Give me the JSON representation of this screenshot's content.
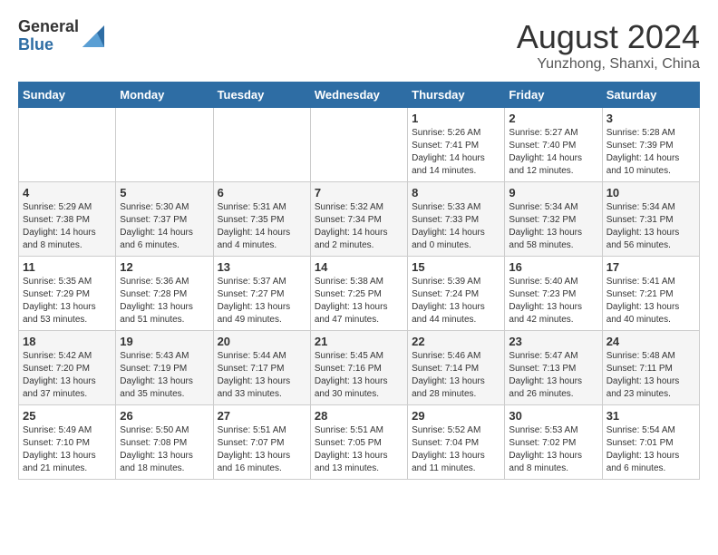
{
  "logo": {
    "general": "General",
    "blue": "Blue"
  },
  "title": "August 2024",
  "subtitle": "Yunzhong, Shanxi, China",
  "days_of_week": [
    "Sunday",
    "Monday",
    "Tuesday",
    "Wednesday",
    "Thursday",
    "Friday",
    "Saturday"
  ],
  "weeks": [
    [
      {
        "day": "",
        "info": ""
      },
      {
        "day": "",
        "info": ""
      },
      {
        "day": "",
        "info": ""
      },
      {
        "day": "",
        "info": ""
      },
      {
        "day": "1",
        "info": "Sunrise: 5:26 AM\nSunset: 7:41 PM\nDaylight: 14 hours\nand 14 minutes."
      },
      {
        "day": "2",
        "info": "Sunrise: 5:27 AM\nSunset: 7:40 PM\nDaylight: 14 hours\nand 12 minutes."
      },
      {
        "day": "3",
        "info": "Sunrise: 5:28 AM\nSunset: 7:39 PM\nDaylight: 14 hours\nand 10 minutes."
      }
    ],
    [
      {
        "day": "4",
        "info": "Sunrise: 5:29 AM\nSunset: 7:38 PM\nDaylight: 14 hours\nand 8 minutes."
      },
      {
        "day": "5",
        "info": "Sunrise: 5:30 AM\nSunset: 7:37 PM\nDaylight: 14 hours\nand 6 minutes."
      },
      {
        "day": "6",
        "info": "Sunrise: 5:31 AM\nSunset: 7:35 PM\nDaylight: 14 hours\nand 4 minutes."
      },
      {
        "day": "7",
        "info": "Sunrise: 5:32 AM\nSunset: 7:34 PM\nDaylight: 14 hours\nand 2 minutes."
      },
      {
        "day": "8",
        "info": "Sunrise: 5:33 AM\nSunset: 7:33 PM\nDaylight: 14 hours\nand 0 minutes."
      },
      {
        "day": "9",
        "info": "Sunrise: 5:34 AM\nSunset: 7:32 PM\nDaylight: 13 hours\nand 58 minutes."
      },
      {
        "day": "10",
        "info": "Sunrise: 5:34 AM\nSunset: 7:31 PM\nDaylight: 13 hours\nand 56 minutes."
      }
    ],
    [
      {
        "day": "11",
        "info": "Sunrise: 5:35 AM\nSunset: 7:29 PM\nDaylight: 13 hours\nand 53 minutes."
      },
      {
        "day": "12",
        "info": "Sunrise: 5:36 AM\nSunset: 7:28 PM\nDaylight: 13 hours\nand 51 minutes."
      },
      {
        "day": "13",
        "info": "Sunrise: 5:37 AM\nSunset: 7:27 PM\nDaylight: 13 hours\nand 49 minutes."
      },
      {
        "day": "14",
        "info": "Sunrise: 5:38 AM\nSunset: 7:25 PM\nDaylight: 13 hours\nand 47 minutes."
      },
      {
        "day": "15",
        "info": "Sunrise: 5:39 AM\nSunset: 7:24 PM\nDaylight: 13 hours\nand 44 minutes."
      },
      {
        "day": "16",
        "info": "Sunrise: 5:40 AM\nSunset: 7:23 PM\nDaylight: 13 hours\nand 42 minutes."
      },
      {
        "day": "17",
        "info": "Sunrise: 5:41 AM\nSunset: 7:21 PM\nDaylight: 13 hours\nand 40 minutes."
      }
    ],
    [
      {
        "day": "18",
        "info": "Sunrise: 5:42 AM\nSunset: 7:20 PM\nDaylight: 13 hours\nand 37 minutes."
      },
      {
        "day": "19",
        "info": "Sunrise: 5:43 AM\nSunset: 7:19 PM\nDaylight: 13 hours\nand 35 minutes."
      },
      {
        "day": "20",
        "info": "Sunrise: 5:44 AM\nSunset: 7:17 PM\nDaylight: 13 hours\nand 33 minutes."
      },
      {
        "day": "21",
        "info": "Sunrise: 5:45 AM\nSunset: 7:16 PM\nDaylight: 13 hours\nand 30 minutes."
      },
      {
        "day": "22",
        "info": "Sunrise: 5:46 AM\nSunset: 7:14 PM\nDaylight: 13 hours\nand 28 minutes."
      },
      {
        "day": "23",
        "info": "Sunrise: 5:47 AM\nSunset: 7:13 PM\nDaylight: 13 hours\nand 26 minutes."
      },
      {
        "day": "24",
        "info": "Sunrise: 5:48 AM\nSunset: 7:11 PM\nDaylight: 13 hours\nand 23 minutes."
      }
    ],
    [
      {
        "day": "25",
        "info": "Sunrise: 5:49 AM\nSunset: 7:10 PM\nDaylight: 13 hours\nand 21 minutes."
      },
      {
        "day": "26",
        "info": "Sunrise: 5:50 AM\nSunset: 7:08 PM\nDaylight: 13 hours\nand 18 minutes."
      },
      {
        "day": "27",
        "info": "Sunrise: 5:51 AM\nSunset: 7:07 PM\nDaylight: 13 hours\nand 16 minutes."
      },
      {
        "day": "28",
        "info": "Sunrise: 5:51 AM\nSunset: 7:05 PM\nDaylight: 13 hours\nand 13 minutes."
      },
      {
        "day": "29",
        "info": "Sunrise: 5:52 AM\nSunset: 7:04 PM\nDaylight: 13 hours\nand 11 minutes."
      },
      {
        "day": "30",
        "info": "Sunrise: 5:53 AM\nSunset: 7:02 PM\nDaylight: 13 hours\nand 8 minutes."
      },
      {
        "day": "31",
        "info": "Sunrise: 5:54 AM\nSunset: 7:01 PM\nDaylight: 13 hours\nand 6 minutes."
      }
    ]
  ]
}
